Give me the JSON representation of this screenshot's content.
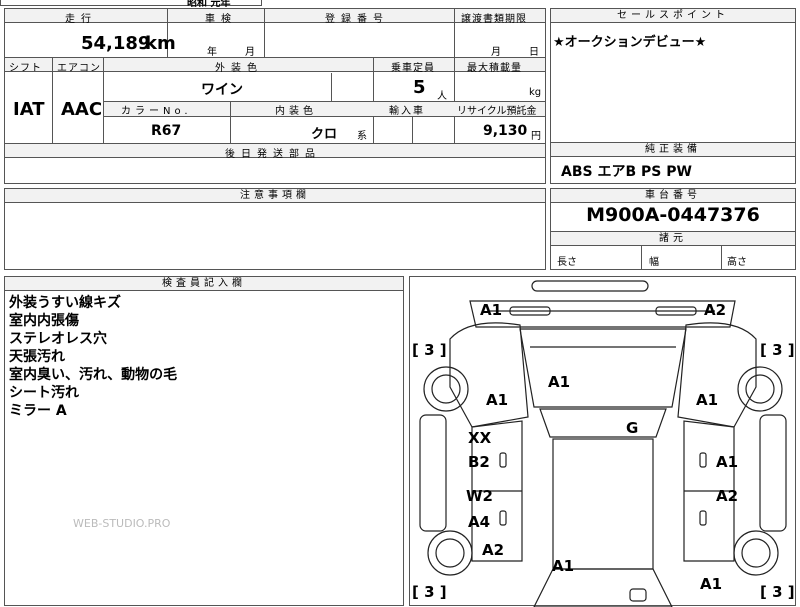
{
  "top_strip": {
    "partial_text": "昭和 元年"
  },
  "labels": {
    "mileage": "走行",
    "inspection": "車検",
    "registration": "登録番号",
    "transfer_deadline": "譲渡書類期限",
    "sales_point": "セールスポイント",
    "shift": "シフト",
    "aircon": "エアコン",
    "exterior_color": "外装色",
    "capacity": "乗車定員",
    "max_load": "最大積載量",
    "color_no": "カラーNo.",
    "interior_color": "内装色",
    "import": "輸入車",
    "recycle": "リサイクル預託金",
    "later_parts": "後日発送部品",
    "standard_equipment": "純正装備",
    "caution": "注意事項欄",
    "chassis_no": "車台番号",
    "dimensions": "諸元",
    "length": "長さ",
    "width": "幅",
    "height": "高さ",
    "inspector": "検査員記入欄"
  },
  "values": {
    "mileage": "54,189",
    "mileage_unit": "km",
    "year_unit": "年",
    "month_unit": "月",
    "deadline_month": "月",
    "deadline_day": "日",
    "sales_point_text": "★オークションデビュー★",
    "shift": "IAT",
    "aircon": "AAC",
    "exterior_color": "ワイン",
    "capacity": "5",
    "capacity_unit": "人",
    "max_load_unit": "kg",
    "color_no": "R67",
    "interior_color": "クロ",
    "interior_suffix": "系",
    "recycle": "9,130",
    "recycle_unit": "円",
    "standard_equipment": "ABS エアB PS PW",
    "chassis_no": "M900A-0447376"
  },
  "inspector_notes": [
    "外装うすい線キズ",
    "室内内張傷",
    "ステレオレス穴",
    "天張汚れ",
    "室内臭い、汚れ、動物の毛",
    "シート汚れ",
    "ミラー A"
  ],
  "watermark": "WEB-STUDIO.PRO",
  "diagram_marks": {
    "front_left": "A1",
    "front_right": "A2",
    "left_bracket_top": "[ 3 ]",
    "right_bracket_top": "[ 3 ]",
    "hood": "A1",
    "left_fender": "A1",
    "right_fender": "A1",
    "roof": "G",
    "left_front_door_1": "XX",
    "left_front_door_2": "B2",
    "right_front_door": "A1",
    "left_rear_door_1": "W2",
    "left_rear_door_2": "A4",
    "right_rear_door": "A2",
    "left_rear_quarter": "A2",
    "trunk": "A1",
    "right_rear": "A1",
    "left_bracket_bottom": "[ 3 ]",
    "right_bracket_bottom": "[ 3 ]"
  }
}
